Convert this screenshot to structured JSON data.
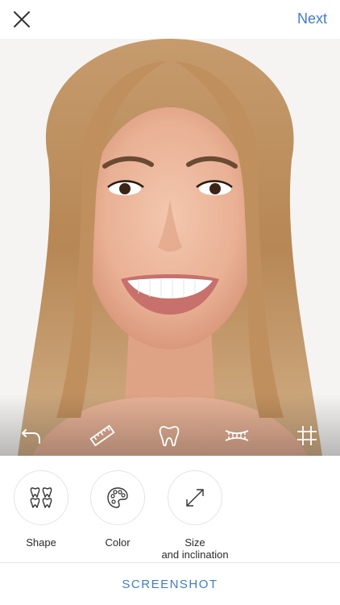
{
  "header": {
    "close_icon": "close-x-icon",
    "next_label": "Next"
  },
  "photo": {
    "subject": "smiling-woman-portrait"
  },
  "toolbar": {
    "tools": [
      {
        "name": "undo-icon"
      },
      {
        "name": "ruler-icon"
      },
      {
        "name": "tooth-icon"
      },
      {
        "name": "teeth-row-icon"
      },
      {
        "name": "grid-icon"
      }
    ]
  },
  "options": [
    {
      "icon": "teeth-shape-icon",
      "label": "Shape"
    },
    {
      "icon": "palette-icon",
      "label": "Color"
    },
    {
      "icon": "resize-arrows-icon",
      "label": "Size\nand inclination"
    }
  ],
  "footer": {
    "label": "SCREENSHOT"
  },
  "colors": {
    "accent": "#3f7dc4",
    "text": "#2b2b2b",
    "icon_stroke": "#333333"
  }
}
